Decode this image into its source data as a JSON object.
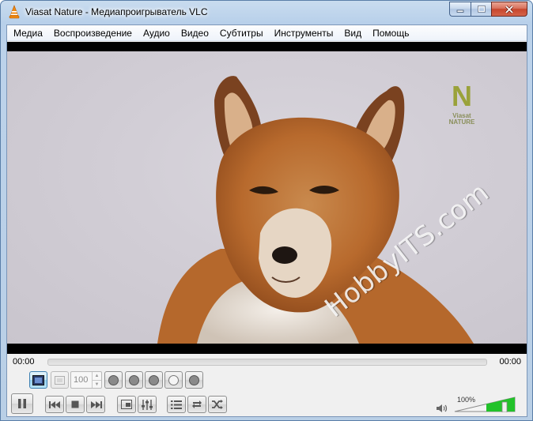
{
  "window": {
    "title": "Viasat Nature - Медиапроигрыватель VLC"
  },
  "menu": [
    "Медиа",
    "Воспроизведение",
    "Аудио",
    "Видео",
    "Субтитры",
    "Инструменты",
    "Вид",
    "Помощь"
  ],
  "video": {
    "channel_logo_letter": "N",
    "channel_logo_text_1": "Viasat",
    "channel_logo_text_2": "NATURE",
    "watermark": "HobbyITS.com"
  },
  "seek": {
    "elapsed": "00:00",
    "total": "00:00",
    "progress": 0
  },
  "advanced": {
    "speed_value": "100"
  },
  "volume": {
    "label": "100%",
    "level": 1.0
  },
  "colors": {
    "volume_fill": "#22c22a",
    "accent": "#3c7fb1",
    "logo": "#8a8f5a"
  }
}
